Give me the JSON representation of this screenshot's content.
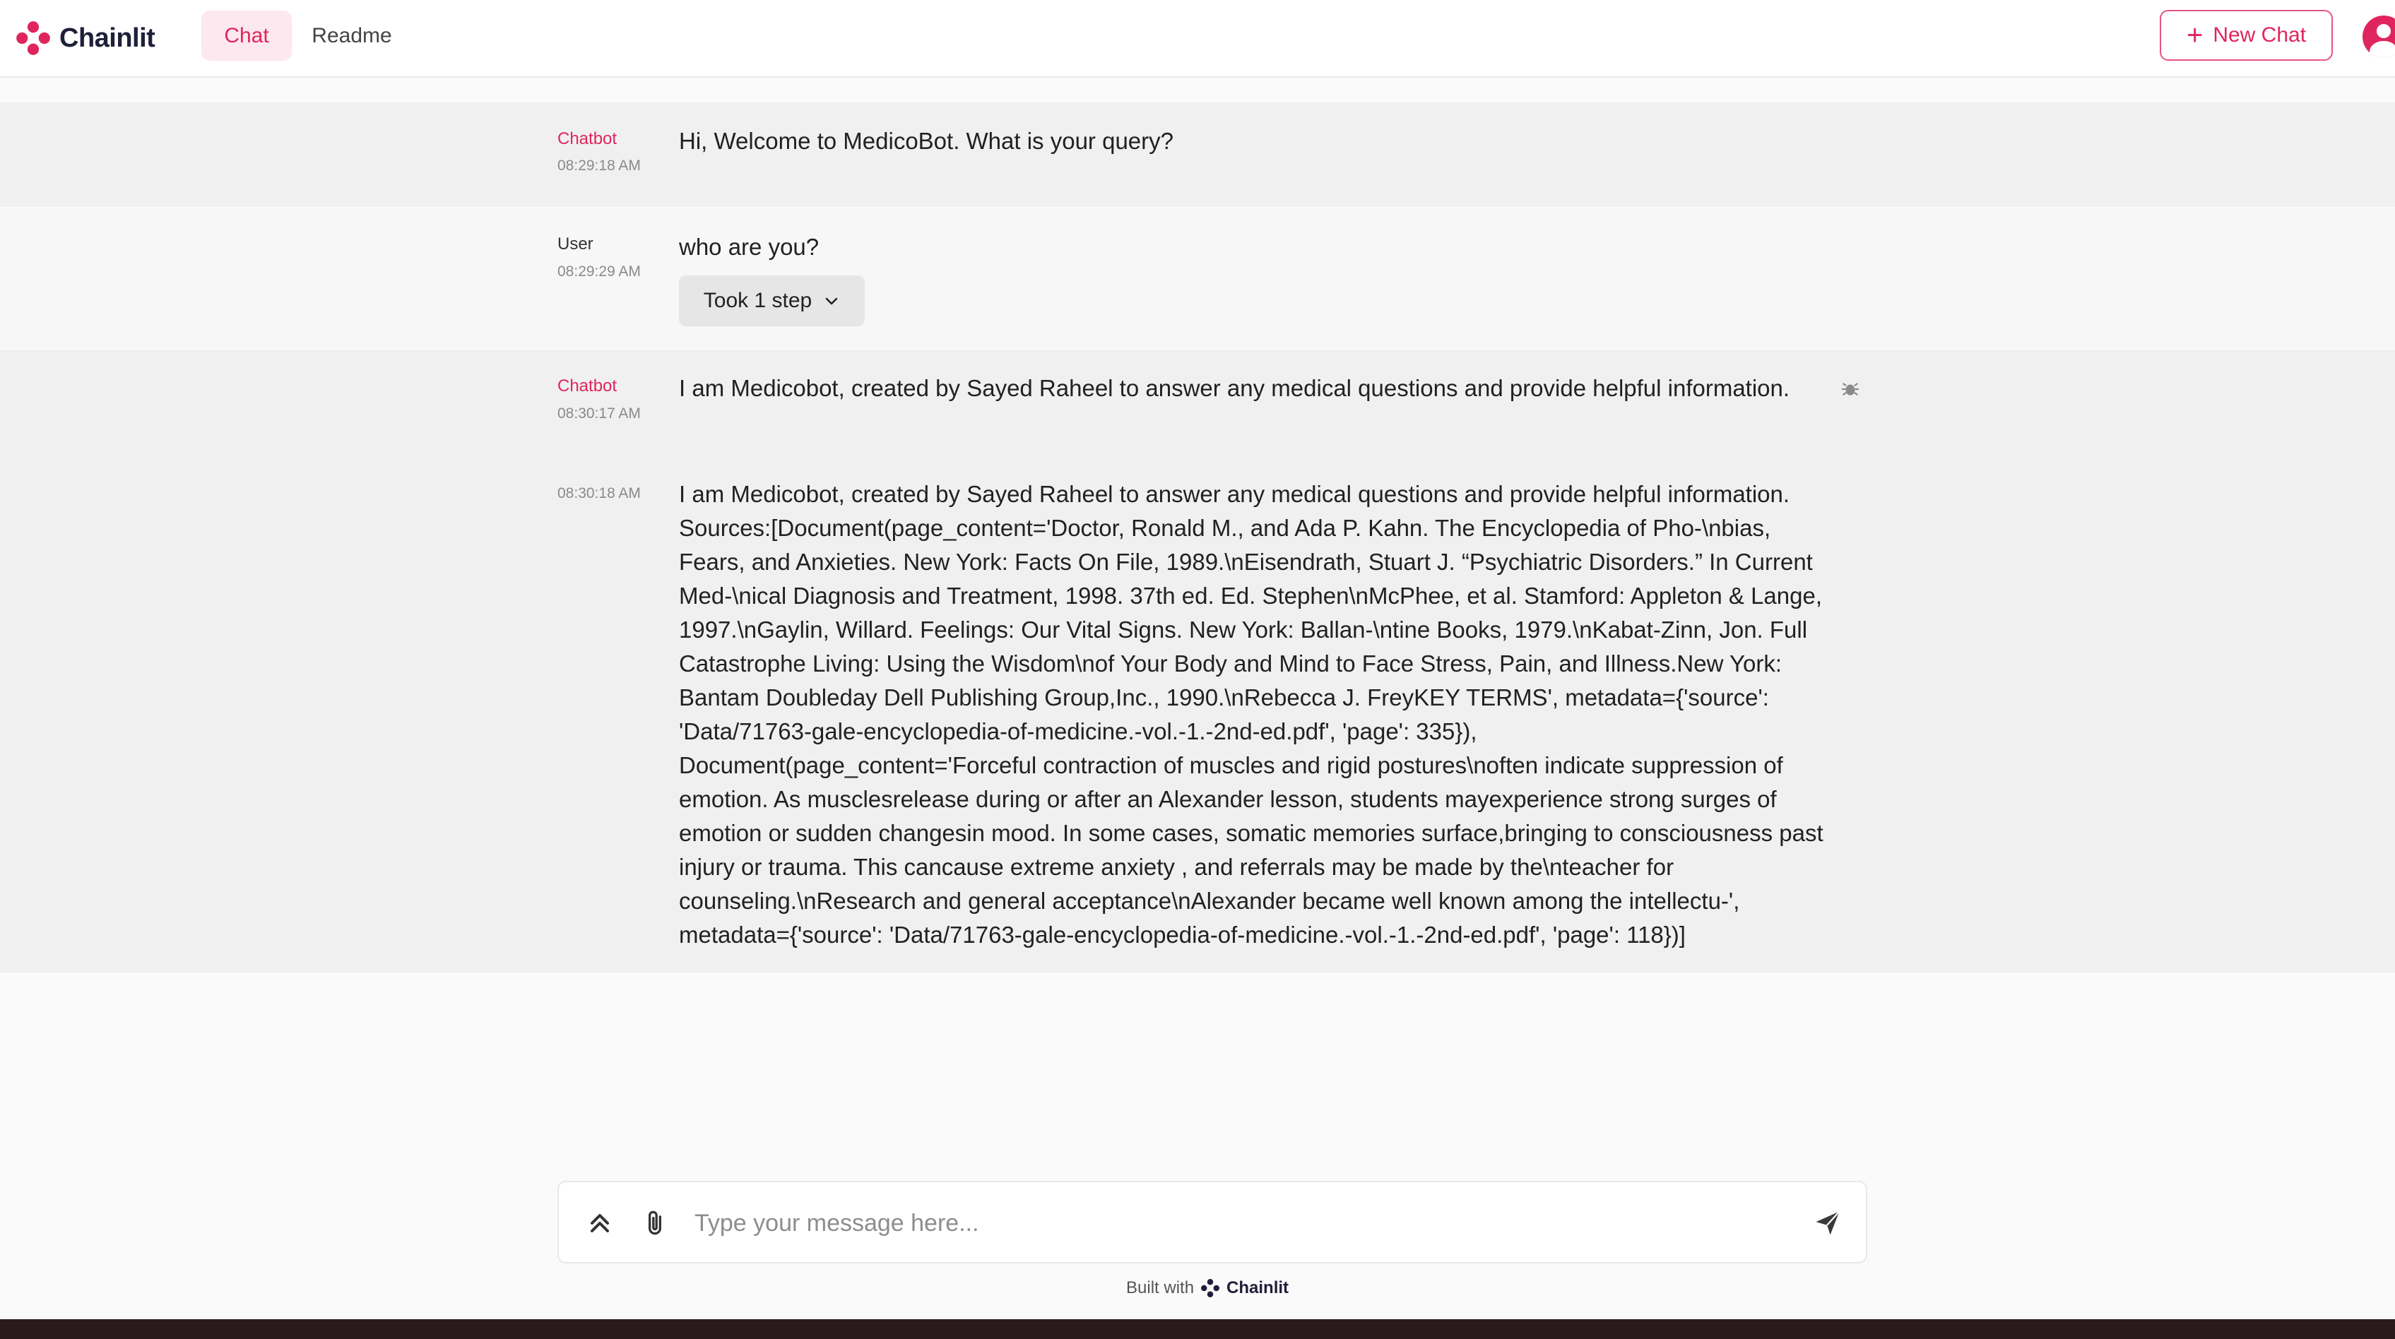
{
  "app": {
    "name": "Chainlit"
  },
  "nav": {
    "tabs": [
      {
        "label": "Chat"
      },
      {
        "label": "Readme"
      }
    ]
  },
  "header": {
    "new_chat_label": "New Chat",
    "avatar_icon": "user-avatar-icon"
  },
  "colors": {
    "accent": "#e0255e",
    "header_bg": "#ffffff",
    "msg_bg_alt": "#f0f0f0"
  },
  "messages": [
    {
      "author": "Chatbot",
      "time": "08:29:18 AM",
      "content": "Hi, Welcome to MedicoBot. What is your query?"
    },
    {
      "author": "User",
      "time": "08:29:29 AM",
      "content": "who are you?",
      "step_label": "Took 1 step"
    },
    {
      "author": "Chatbot",
      "time": "08:30:17 AM",
      "content": "I am Medicobot, created by Sayed Raheel to answer any medical questions and provide helpful information."
    },
    {
      "author": "",
      "time": "08:30:18 AM",
      "lines": [
        "I am Medicobot, created by Sayed Raheel to answer any medical questions and provide helpful information.",
        "Sources:[Document(page_content='Doctor, Ronald M., and Ada P. Kahn. The Encyclopedia of Pho-\\nbias,",
        "Fears, and Anxieties. New York: Facts On File, 1989.\\nEisendrath, Stuart J. “Psychiatric Disorders.” In Current",
        "Med-\\nical Diagnosis and Treatment, 1998. 37th ed. Ed. Stephen\\nMcPhee, et al. Stamford: Appleton & Lange,",
        "1997.\\nGaylin, Willard. Feelings: Our Vital Signs. New York: Ballan-\\ntine Books, 1979.\\nKabat-Zinn, Jon. Full",
        "Catastrophe Living: Using the Wisdom\\nof Your Body and Mind to Face Stress, Pain, and Illness.New York:",
        "Bantam Doubleday Dell Publishing Group,Inc., 1990.\\nRebecca J. FreyKEY TERMS', metadata={'source':",
        "'Data/71763-gale-encyclopedia-of-medicine.-vol.-1.-2nd-ed.pdf', 'page': 335}),",
        "Document(page_content='Forceful contraction of muscles and rigid postures\\noften indicate suppression of",
        "emotion. As musclesrelease during or after an Alexander lesson, students mayexperience strong surges of",
        "emotion or sudden changesin mood. In some cases, somatic memories surface,bringing to consciousness past",
        "injury or trauma. This cancause extreme anxiety , and referrals may be made by the\\nteacher for",
        "counseling.\\nResearch and general acceptance\\nAlexander became well known among the intellectu-',",
        "metadata={'source': 'Data/71763-gale-encyclopedia-of-medicine.-vol.-1.-2nd-ed.pdf', 'page': 118})]"
      ]
    }
  ],
  "composer": {
    "placeholder": "Type your message here..."
  },
  "footer": {
    "built_with": "Built with",
    "brand": "Chainlit"
  }
}
